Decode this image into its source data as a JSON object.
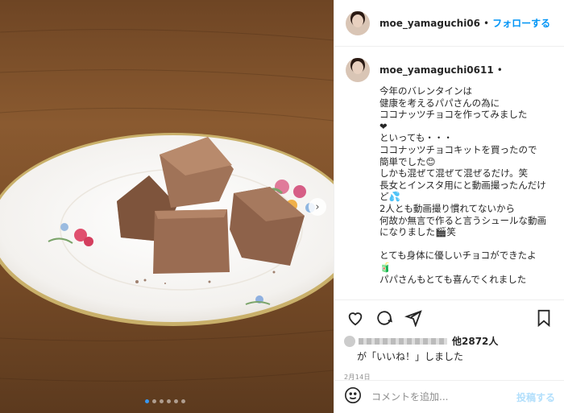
{
  "header": {
    "username": "moe_yamaguchi06",
    "separator": "•",
    "follow_label": "フォローする"
  },
  "caption": {
    "username": "moe_yamaguchi0611",
    "separator": "•",
    "text": "今年のバレンタインは\n健康を考えるパパさんの為に\nココナッツチョコを作ってみました\n❤\nといっても・・・\nココナッツチョコキットを買ったので\n簡単でした😊\nしかも混ぜて混ぜて混ぜるだけ。笑\n長女とインスタ用にと動画撮ったんだけど💦\n2人とも動画撮り慣れてないから\n何故か無言で作ると言うシュールな動画になりました🎬笑\n\nとても身体に優しいチョコができたよ\n🧃\nパパさんもとても喜んでくれました"
  },
  "likes": {
    "count_text": "他2872人",
    "suffix": "が「いいね！」しました"
  },
  "date": "2月14日",
  "comment": {
    "placeholder": "コメントを追加...",
    "post_label": "投稿する"
  },
  "icons": {
    "like": "heart-icon",
    "comment": "comment-icon",
    "share": "share-icon",
    "save": "bookmark-icon",
    "emoji": "emoji-icon",
    "next": "chevron-right-icon"
  },
  "colors": {
    "accent": "#0095f6",
    "post_disabled": "#b2dffc"
  },
  "carousel": {
    "total": 6,
    "active": 1
  }
}
